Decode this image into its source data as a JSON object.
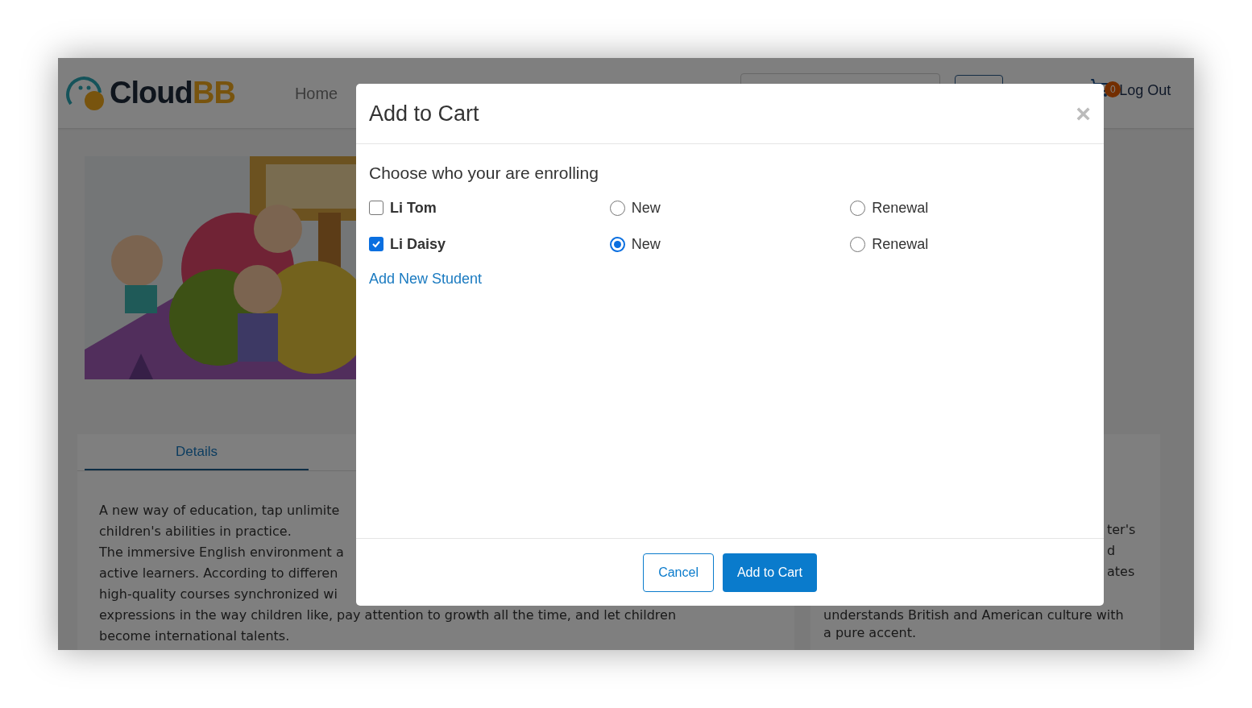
{
  "navbar": {
    "logo": {
      "main": "Cloud",
      "accent": "BB"
    },
    "links": [
      "Home"
    ],
    "cart_count": "0",
    "logout": "Log Out"
  },
  "course": {
    "picture": {
      "kind": "picture"
    },
    "tabs": [
      {
        "label": "Details",
        "selected": true
      }
    ],
    "left_lines": [
      "A new way of education, tap unlimite",
      "children's abilities in practice.",
      "The immersive English environment a",
      "active learners. According to differen",
      "high-quality courses synchronized wi",
      "expressions in the way children like, pay attention to growth all the time, and let children",
      "become international talents."
    ],
    "right_fragments": [
      "ter's",
      "d",
      "ates"
    ],
    "right_lines": [
      "understands British and American culture with",
      "a pure accent."
    ]
  },
  "modal": {
    "title": "Add to Cart",
    "close": "×",
    "prompt": "Choose who your are enrolling",
    "students": [
      {
        "name": "Li Tom",
        "checked": false,
        "options": [
          {
            "label": "New",
            "selected": false
          },
          {
            "label": "Renewal",
            "selected": false
          }
        ]
      },
      {
        "name": "Li Daisy",
        "checked": true,
        "options": [
          {
            "label": "New",
            "selected": true
          },
          {
            "label": "Renewal",
            "selected": false
          }
        ]
      }
    ],
    "add_link": "Add New Student",
    "buttons": [
      {
        "label": "Cancel",
        "kind": "secondary"
      },
      {
        "label": "Add to Cart",
        "kind": "primary"
      }
    ]
  }
}
